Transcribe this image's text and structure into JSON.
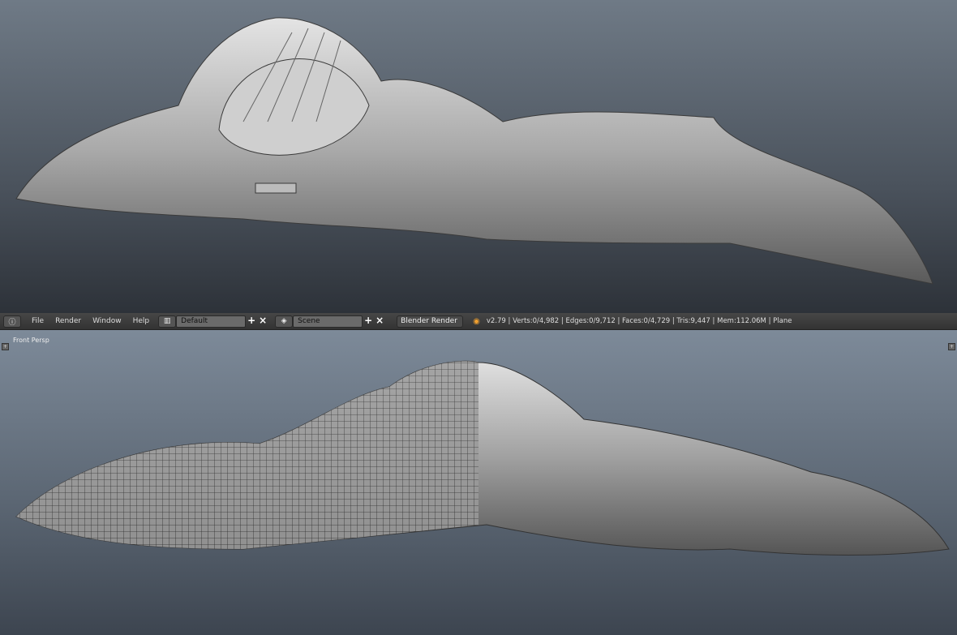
{
  "header": {
    "info_icon": "info-icon",
    "menus": [
      "File",
      "Render",
      "Window",
      "Help"
    ],
    "screen_layout": "Default",
    "scene": "Scene",
    "render_engine": "Blender Render",
    "stats": "v2.79 | Verts:0/4,982 | Edges:0/9,712 | Faces:0/4,729 | Tris:9,447 | Mem:112.06M | Plane"
  },
  "viewport": {
    "label": "Front Persp"
  }
}
